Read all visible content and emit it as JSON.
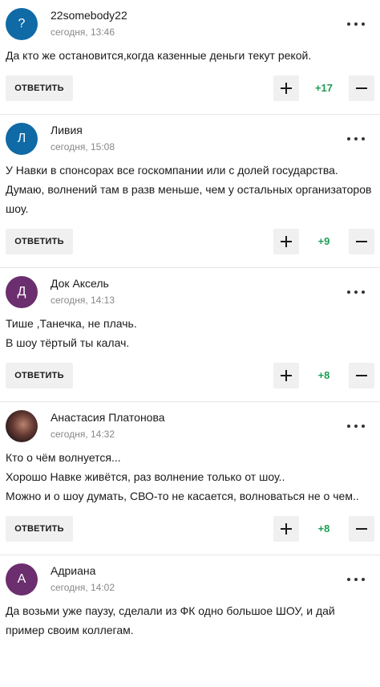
{
  "comments": [
    {
      "author": "22somebody22",
      "date": "сегодня, 13:46",
      "avatar_letter": "?",
      "avatar_color": "#0f6aa6",
      "text": [
        "Да кто же остановится,когда казенные деньги текут рекой."
      ],
      "reply_label": "ОТВЕТИТЬ",
      "score": "+17"
    },
    {
      "author": "Ливия",
      "date": "сегодня, 15:08",
      "avatar_letter": "Л",
      "avatar_color": "#0f6aa6",
      "text": [
        "У Навки в спонсорах все госкомпании или с долей государства. Думаю, волнений там в разв меньше, чем у остальных организаторов шоу."
      ],
      "reply_label": "ОТВЕТИТЬ",
      "score": "+9"
    },
    {
      "author": "Док Аксель",
      "date": "сегодня, 14:13",
      "avatar_letter": "Д",
      "avatar_color": "#6b2e6e",
      "text": [
        "Тише ,Танечка, не плачь.",
        "В шоу тёртый ты калач."
      ],
      "reply_label": "ОТВЕТИТЬ",
      "score": "+8"
    },
    {
      "author": "Анастасия Платонова",
      "date": "сегодня, 14:32",
      "avatar_letter": "",
      "avatar_color": "#5a3a34",
      "text": [
        "Кто о чём волнуется...",
        "Хорошо Навке живётся, раз волнение только от шоу..",
        "Можно и о шоу думать, СВО-то не касается, волноваться не о чем.."
      ],
      "reply_label": "ОТВЕТИТЬ",
      "score": "+8"
    },
    {
      "author": "Адриана",
      "date": "сегодня, 14:02",
      "avatar_letter": "А",
      "avatar_color": "#6b2e6e",
      "text": [
        "Да возьми уже паузу, сделали из ФК одно большое ШОУ, и дай пример своим коллегам."
      ],
      "reply_label": "",
      "score": ""
    }
  ]
}
